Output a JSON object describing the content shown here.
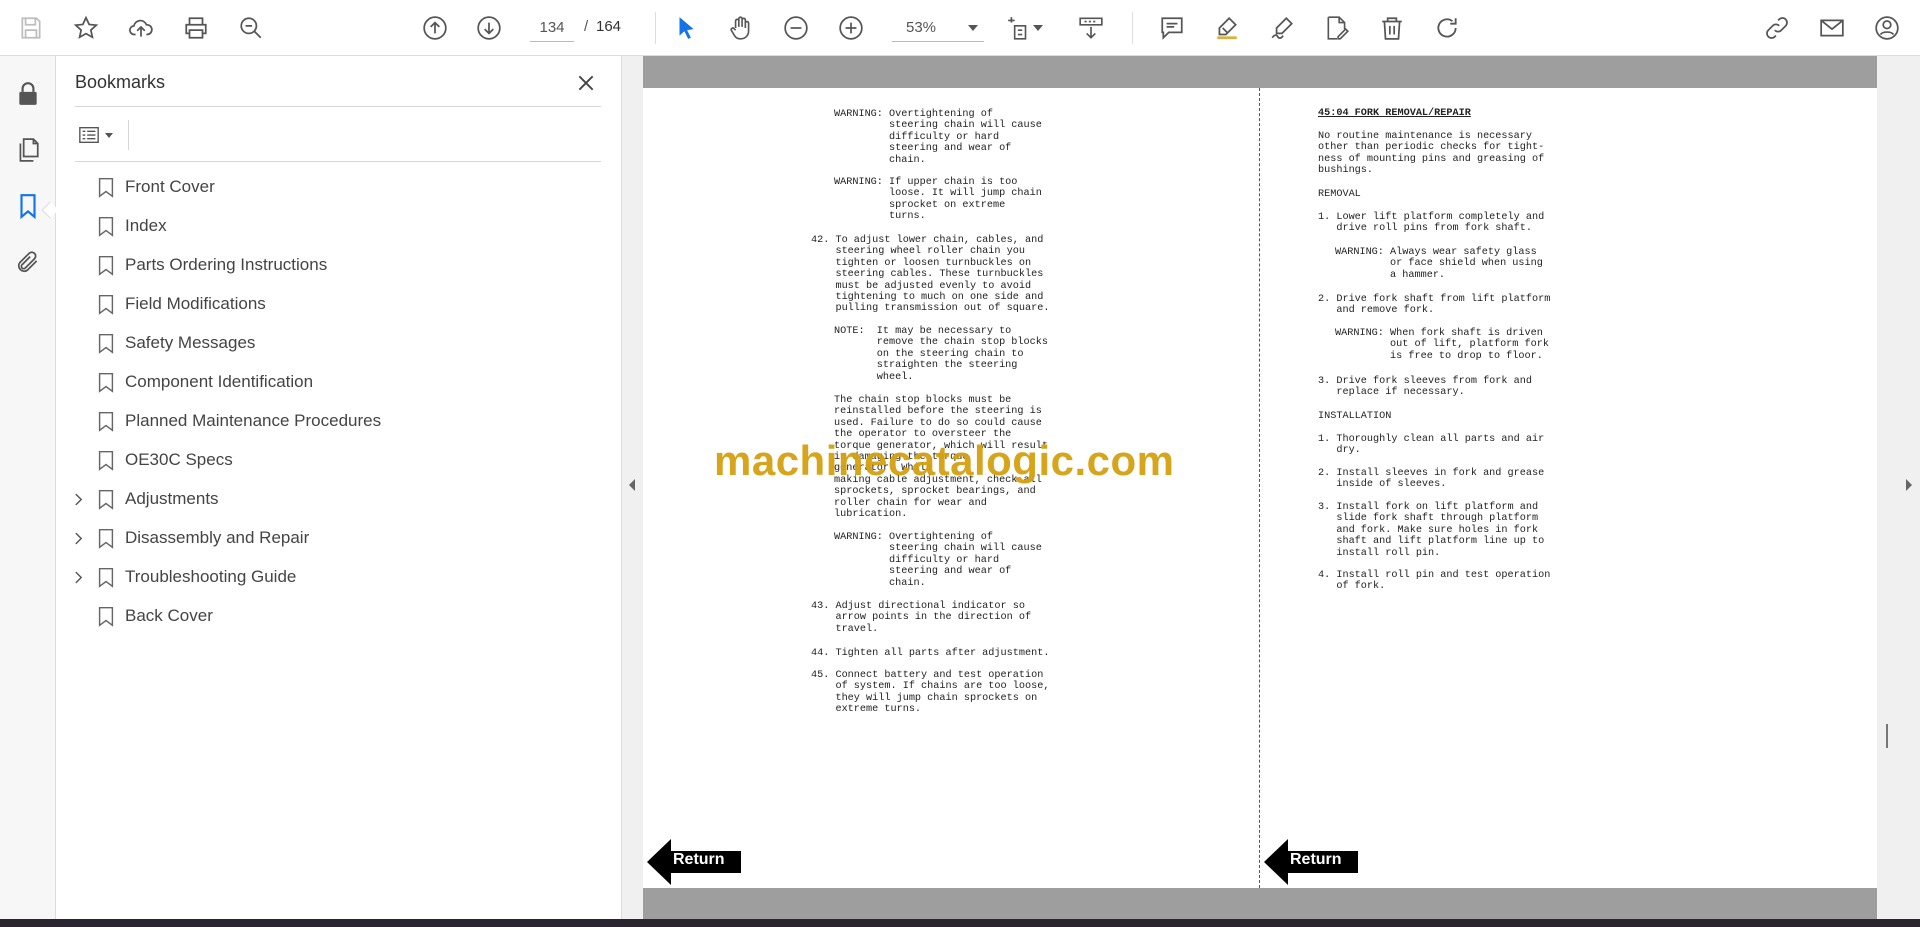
{
  "toolbar": {
    "current_page": "134",
    "page_separator": "/",
    "total_pages": "164",
    "zoom": "53%",
    "icons": [
      "save-icon",
      "bookmark-star-icon",
      "upload-icon",
      "print-icon",
      "search-zoom-icon",
      "previous-page-icon",
      "next-page-icon",
      "select-cursor-icon",
      "hand-tool-icon",
      "zoom-out-icon",
      "zoom-in-icon",
      "page-fit-icon",
      "scroll-mode-icon",
      "comment-icon",
      "highlight-icon",
      "sign-icon",
      "edit-pdf-icon",
      "delete-icon",
      "rotate-icon",
      "share-link-icon",
      "email-icon",
      "account-icon"
    ],
    "accent_color": "#1473e6"
  },
  "rail": {
    "icons": [
      "lock-icon",
      "pages-icon",
      "bookmark-icon",
      "attachment-icon"
    ]
  },
  "bookmarks_panel": {
    "title": "Bookmarks",
    "items": [
      {
        "label": "Front Cover",
        "expandable": false
      },
      {
        "label": "Index",
        "expandable": false
      },
      {
        "label": "Parts Ordering Instructions",
        "expandable": false
      },
      {
        "label": "Field Modifications",
        "expandable": false
      },
      {
        "label": "Safety Messages",
        "expandable": false
      },
      {
        "label": "Component Identification",
        "expandable": false
      },
      {
        "label": "Planned Maintenance Procedures",
        "expandable": false
      },
      {
        "label": "OE30C Specs",
        "expandable": false
      },
      {
        "label": "Adjustments",
        "expandable": true
      },
      {
        "label": "Disassembly and Repair",
        "expandable": true
      },
      {
        "label": "Troubleshooting Guide",
        "expandable": true
      },
      {
        "label": "Back Cover",
        "expandable": false
      }
    ]
  },
  "document": {
    "watermark": "machinecatalogic.com",
    "left_page": {
      "w1": "WARNING: Overtightening of\n         steering chain will cause\n         difficulty or hard\n         steering and wear of\n         chain.",
      "w2": "WARNING: If upper chain is too\n         loose. It will jump chain\n         sprocket on extreme\n         turns.",
      "s42": "42. To adjust lower chain, cables, and\n    steering wheel roller chain you\n    tighten or loosen turnbuckles on\n    steering cables. These turnbuckles\n    must be adjusted evenly to avoid\n    tightening to much on one side and\n    pulling transmission out of square.",
      "note": "NOTE:  It may be necessary to\n       remove the chain stop blocks\n       on the steering chain to\n       straighten the steering\n       wheel.",
      "para": "The chain stop blocks must be\nreinstalled before the steering is\nused. Failure to do so could cause\nthe operator to oversteer the\ntorque generator, which will result\nin damaging the torque\ngenerator. While\nmaking cable adjustment, check all\nsprockets, sprocket bearings, and\nroller chain for wear and\nlubrication.",
      "w3": "WARNING: Overtightening of\n         steering chain will cause\n         difficulty or hard\n         steering and wear of\n         chain.",
      "s43": "43. Adjust directional indicator so\n    arrow points in the direction of\n    travel.",
      "s44": "44. Tighten all parts after adjustment.",
      "s45": "45. Connect battery and test operation\n    of system. If chains are too loose,\n    they will jump chain sprockets on\n    extreme turns."
    },
    "right_page": {
      "heading": "45:04 FORK REMOVAL/REPAIR",
      "intro": "No routine maintenance is necessary\nother than periodic checks for tight-\nness of mounting pins and greasing of\nbushings.",
      "removal_heading": "REMOVAL",
      "r1": "1. Lower lift platform completely and\n   drive roll pins from fork shaft.",
      "rw1": "WARNING: Always wear safety glass\n         or face shield when using\n         a hammer.",
      "r2": "2. Drive fork shaft from lift platform\n   and remove fork.",
      "rw2": "WARNING: When fork shaft is driven\n         out of lift, platform fork\n         is free to drop to floor.",
      "r3": "3. Drive fork sleeves from fork and\n   replace if necessary.",
      "install_heading": "INSTALLATION",
      "i1": "1. Thoroughly clean all parts and air\n   dry.",
      "i2": "2. Install sleeves in fork and grease\n   inside of sleeves.",
      "i3": "3. Install fork on lift platform and\n   slide fork shaft through platform\n   and fork. Make sure holes in fork\n   shaft and lift platform line up to\n   install roll pin.",
      "i4": "4. Install roll pin and test operation\n   of fork."
    },
    "return_label": "Return"
  }
}
